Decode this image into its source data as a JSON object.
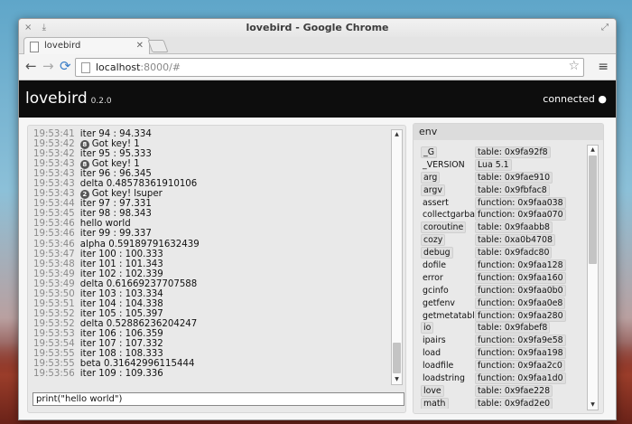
{
  "window": {
    "title": "lovebird - Google Chrome",
    "titlebar_left_icons": [
      "×",
      "⤓"
    ],
    "titlebar_right_icon": "⤢"
  },
  "tab": {
    "label": "lovebird",
    "close": "✕"
  },
  "toolbar": {
    "url_host": "localhost",
    "url_path": ":8000/#",
    "back_glyph": "←",
    "forward_glyph": "→",
    "reload_glyph": "⟳",
    "star_glyph": "☆",
    "menu_glyph": "≡"
  },
  "app": {
    "title": "lovebird",
    "version": "0.2.0",
    "status": "connected ●"
  },
  "console": {
    "input_value": "print(\"hello world\")",
    "lines": [
      {
        "time": "19:53:41",
        "badge": "",
        "text": "iter 94 : 94.334"
      },
      {
        "time": "19:53:42",
        "badge": "8",
        "text": "Got key! 1"
      },
      {
        "time": "19:53:42",
        "badge": "",
        "text": "iter 95 : 95.333"
      },
      {
        "time": "19:53:43",
        "badge": "8",
        "text": "Got key! 1"
      },
      {
        "time": "19:53:43",
        "badge": "",
        "text": "iter 96 : 96.345"
      },
      {
        "time": "19:53:43",
        "badge": "",
        "text": "delta 0.48578361910106"
      },
      {
        "time": "19:53:43",
        "badge": "2",
        "text": "Got key! lsuper"
      },
      {
        "time": "19:53:44",
        "badge": "",
        "text": "iter 97 : 97.331"
      },
      {
        "time": "19:53:45",
        "badge": "",
        "text": "iter 98 : 98.343"
      },
      {
        "time": "19:53:46",
        "badge": "",
        "text": "hello world"
      },
      {
        "time": "19:53:46",
        "badge": "",
        "text": "iter 99 : 99.337"
      },
      {
        "time": "19:53:46",
        "badge": "",
        "text": "alpha 0.59189791632439"
      },
      {
        "time": "19:53:47",
        "badge": "",
        "text": "iter 100 : 100.333"
      },
      {
        "time": "19:53:48",
        "badge": "",
        "text": "iter 101 : 101.343"
      },
      {
        "time": "19:53:49",
        "badge": "",
        "text": "iter 102 : 102.339"
      },
      {
        "time": "19:53:49",
        "badge": "",
        "text": "delta 0.61669237707588"
      },
      {
        "time": "19:53:50",
        "badge": "",
        "text": "iter 103 : 103.334"
      },
      {
        "time": "19:53:51",
        "badge": "",
        "text": "iter 104 : 104.338"
      },
      {
        "time": "19:53:52",
        "badge": "",
        "text": "iter 105 : 105.397"
      },
      {
        "time": "19:53:52",
        "badge": "",
        "text": "delta 0.52886236204247"
      },
      {
        "time": "19:53:53",
        "badge": "",
        "text": "iter 106 : 106.359"
      },
      {
        "time": "19:53:54",
        "badge": "",
        "text": "iter 107 : 107.332"
      },
      {
        "time": "19:53:55",
        "badge": "",
        "text": "iter 108 : 108.333"
      },
      {
        "time": "19:53:55",
        "badge": "",
        "text": "beta 0.31642996115444"
      },
      {
        "time": "19:53:56",
        "badge": "",
        "text": "iter 109 : 109.336"
      }
    ]
  },
  "env": {
    "title": "env",
    "rows": [
      {
        "key": "_G",
        "boxed": true,
        "value": "table: 0x9fa92f8"
      },
      {
        "key": "_VERSION",
        "boxed": false,
        "value": "Lua 5.1"
      },
      {
        "key": "arg",
        "boxed": true,
        "value": "table: 0x9fae910"
      },
      {
        "key": "argv",
        "boxed": true,
        "value": "table: 0x9fbfac8"
      },
      {
        "key": "assert",
        "boxed": false,
        "value": "function: 0x9faa038"
      },
      {
        "key": "collectgarbage",
        "boxed": false,
        "value": "function: 0x9faa070"
      },
      {
        "key": "coroutine",
        "boxed": true,
        "value": "table: 0x9faabb8"
      },
      {
        "key": "cozy",
        "boxed": true,
        "value": "table: 0xa0b4708"
      },
      {
        "key": "debug",
        "boxed": true,
        "value": "table: 0x9fadc80"
      },
      {
        "key": "dofile",
        "boxed": false,
        "value": "function: 0x9faa128"
      },
      {
        "key": "error",
        "boxed": false,
        "value": "function: 0x9faa160"
      },
      {
        "key": "gcinfo",
        "boxed": false,
        "value": "function: 0x9faa0b0"
      },
      {
        "key": "getfenv",
        "boxed": false,
        "value": "function: 0x9faa0e8"
      },
      {
        "key": "getmetatable",
        "boxed": false,
        "value": "function: 0x9faa280"
      },
      {
        "key": "io",
        "boxed": true,
        "value": "table: 0x9fabef8"
      },
      {
        "key": "ipairs",
        "boxed": false,
        "value": "function: 0x9fa9e58"
      },
      {
        "key": "load",
        "boxed": false,
        "value": "function: 0x9faa198"
      },
      {
        "key": "loadfile",
        "boxed": false,
        "value": "function: 0x9faa2c0"
      },
      {
        "key": "loadstring",
        "boxed": false,
        "value": "function: 0x9faa1d0"
      },
      {
        "key": "love",
        "boxed": true,
        "value": "table: 0x9fae228"
      },
      {
        "key": "math",
        "boxed": true,
        "value": "table: 0x9fad2e0"
      }
    ]
  }
}
